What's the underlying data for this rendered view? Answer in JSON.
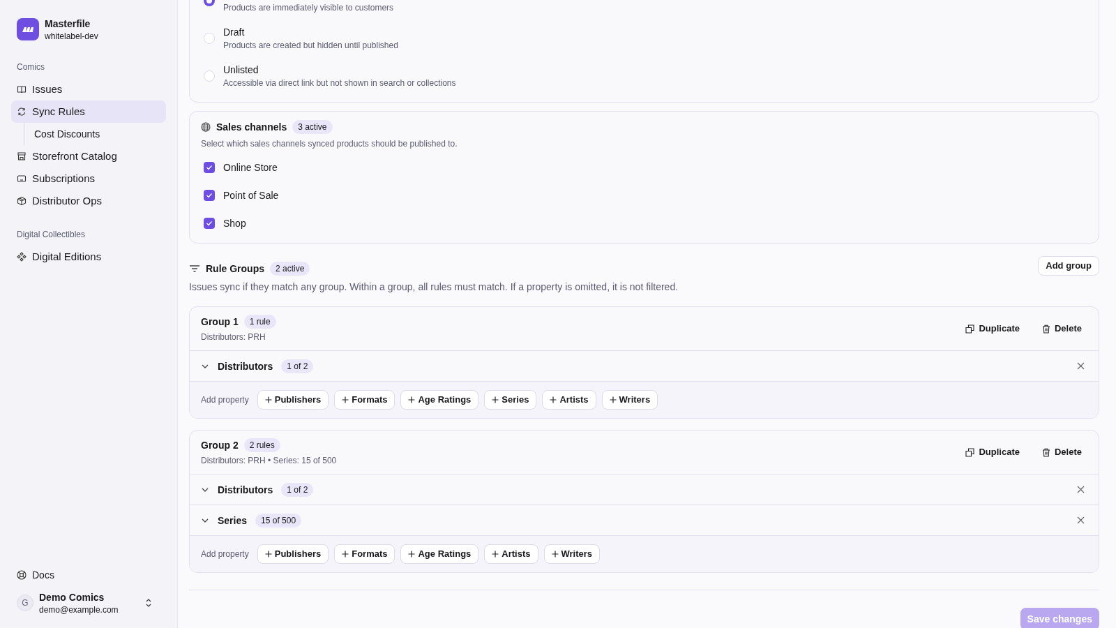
{
  "sidebar": {
    "brand": {
      "name": "Masterfile",
      "workspace": "whitelabel-dev"
    },
    "sections": [
      {
        "label": "Comics",
        "items": [
          {
            "label": "Issues",
            "selected": false
          },
          {
            "label": "Sync Rules",
            "selected": true,
            "children": [
              {
                "label": "Cost Discounts",
                "selected": false
              }
            ]
          },
          {
            "label": "Storefront Catalog",
            "selected": false
          },
          {
            "label": "Subscriptions",
            "selected": false
          },
          {
            "label": "Distributor Ops",
            "selected": false
          }
        ]
      },
      {
        "label": "Digital Collectibles",
        "items": [
          {
            "label": "Digital Editions",
            "selected": false
          }
        ]
      }
    ],
    "docs": "Docs",
    "account": {
      "avatar": "G",
      "name": "Demo Comics",
      "email": "demo@example.com"
    }
  },
  "publish_status": {
    "options": [
      {
        "description": "Products are immediately visible to customers",
        "selected": true
      },
      {
        "label": "Draft",
        "description": "Products are created but hidden until published",
        "selected": false
      },
      {
        "label": "Unlisted",
        "description": "Accessible via direct link but not shown in search or collections",
        "selected": false
      }
    ]
  },
  "sales_channels": {
    "title": "Sales channels",
    "badge": "3 active",
    "description": "Select which sales channels synced products should be published to.",
    "channels": [
      {
        "label": "Online Store",
        "checked": true
      },
      {
        "label": "Point of Sale",
        "checked": true
      },
      {
        "label": "Shop",
        "checked": true
      }
    ]
  },
  "rule_groups": {
    "title": "Rule Groups",
    "badge": "2 active",
    "description": "Issues sync if they match any group. Within a group, all rules must match. If a property is omitted, it is not filtered.",
    "add_button": "Add group",
    "groups": [
      {
        "title": "Group 1",
        "badge": "1 rule",
        "summary": "Distributors: PRH",
        "duplicate": "Duplicate",
        "delete": "Delete",
        "rules": [
          {
            "label": "Distributors",
            "badge": "1 of 2",
            "expanded": false
          }
        ],
        "add_property_label": "Add property",
        "properties": [
          "Publishers",
          "Formats",
          "Age Ratings",
          "Series",
          "Artists",
          "Writers"
        ]
      },
      {
        "title": "Group 2",
        "badge": "2 rules",
        "summary": "Distributors: PRH • Series: 15 of 500",
        "duplicate": "Duplicate",
        "delete": "Delete",
        "rules": [
          {
            "label": "Distributors",
            "badge": "1 of 2",
            "expanded": false
          },
          {
            "label": "Series",
            "badge": "15 of 500",
            "expanded": false
          }
        ],
        "add_property_label": "Add property",
        "properties": [
          "Publishers",
          "Formats",
          "Age Ratings",
          "Artists",
          "Writers"
        ]
      }
    ]
  },
  "save_button": {
    "label": "Save changes",
    "disabled": true
  }
}
